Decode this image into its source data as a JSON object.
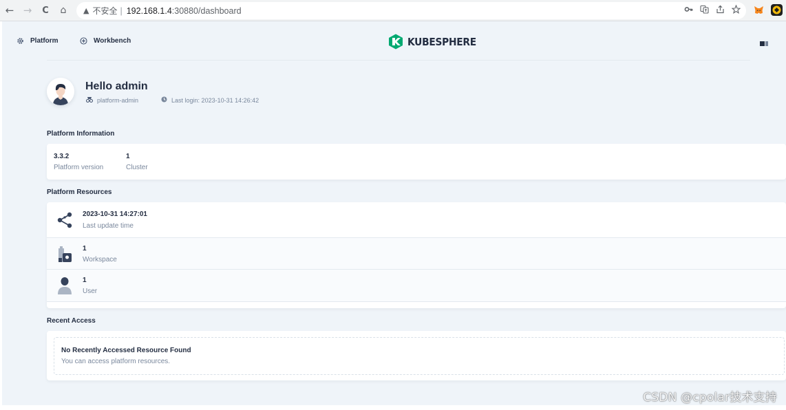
{
  "browser": {
    "back_icon": "←",
    "forward_icon": "→",
    "reload_icon": "C",
    "home_icon": "⌂",
    "warning_icon": "▲",
    "insecure_label": "不安全",
    "separator": "|",
    "url_host": "192.168.1.4",
    "url_path": ":30880/dashboard",
    "right_icons": [
      "key-icon",
      "translate-icon",
      "share-icon",
      "star-icon"
    ],
    "extensions": [
      "metamask-icon",
      "extension-icon"
    ]
  },
  "nav": {
    "platform_label": "Platform",
    "workbench_label": "Workbench",
    "logo_text": "KUBESPHERE",
    "brand_color": "#00a971"
  },
  "greeting": {
    "title": "Hello admin",
    "role": "platform-admin",
    "last_login": "Last login: 2023-10-31 14:26:42"
  },
  "platform_info": {
    "section_title": "Platform Information",
    "items": [
      {
        "value": "3.3.2",
        "label": "Platform version"
      },
      {
        "value": "1",
        "label": "Cluster"
      }
    ]
  },
  "platform_resources": {
    "section_title": "Platform Resources",
    "rows": [
      {
        "icon": "nodes-icon",
        "value": "2023-10-31 14:27:01",
        "label": "Last update time"
      },
      {
        "icon": "workspace-icon",
        "value": "1",
        "label": "Workspace"
      },
      {
        "icon": "user-icon",
        "value": "1",
        "label": "User"
      }
    ]
  },
  "recent_access": {
    "section_title": "Recent Access",
    "empty_title": "No Recently Accessed Resource Found",
    "empty_desc": "You can access platform resources."
  },
  "watermark": "CSDN @cpolar技术支持"
}
